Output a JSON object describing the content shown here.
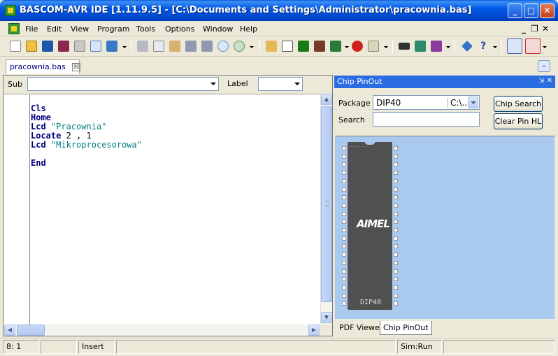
{
  "window": {
    "title": "BASCOM-AVR IDE [1.11.9.5] - [C:\\Documents and Settings\\Administrator\\pracownia.bas]",
    "controls": {
      "minimize": "_",
      "maximize": "□",
      "close": "✕"
    }
  },
  "menu": {
    "items": [
      "File",
      "Edit",
      "View",
      "Program",
      "Tools",
      "Options",
      "Window",
      "Help"
    ],
    "mdi_controls": {
      "minimize": "_",
      "restore": "❐",
      "close": "✕"
    }
  },
  "toolbar": {
    "icons": [
      "new-file-icon",
      "open-folder-icon",
      "save-icon",
      "save-as-icon",
      "print-icon",
      "print-preview-icon",
      "bookmark-icon",
      "cut-icon",
      "copy-icon",
      "paste-icon",
      "indent-icon",
      "unindent-icon",
      "find-icon",
      "find-next-icon",
      "hand-icon",
      "syntax-check-icon",
      "compile-icon",
      "chip-icon",
      "program-icon",
      "stop-icon",
      "terminal-icon",
      "chip-program-icon",
      "lcd-icon",
      "analyzer-icon",
      "info-icon",
      "help-icon",
      "chip-pinout-icon",
      "pdf-icon"
    ],
    "colors": {
      "save": "#1c56a8",
      "stop": "#d02020",
      "compile": "#1a7a1a",
      "pdf": "#c83030"
    }
  },
  "tabs": {
    "document": "pracownia.bas",
    "close": "☒",
    "chevron": "⌄"
  },
  "editor": {
    "sub_label": "Sub",
    "sub_value": "",
    "label_label": "Label",
    "label_value": "",
    "code": [
      {
        "parts": [
          {
            "t": "Cls",
            "c": "kw"
          }
        ]
      },
      {
        "parts": [
          {
            "t": "Home",
            "c": "kw"
          }
        ]
      },
      {
        "parts": [
          {
            "t": "Lcd",
            "c": "kw"
          },
          {
            "t": " ",
            "c": "num"
          },
          {
            "t": "\"Pracownia\"",
            "c": "str"
          }
        ]
      },
      {
        "parts": [
          {
            "t": "Locate",
            "c": "kw"
          },
          {
            "t": " 2 , 1",
            "c": "num"
          }
        ]
      },
      {
        "parts": [
          {
            "t": "Lcd",
            "c": "kw"
          },
          {
            "t": " ",
            "c": "num"
          },
          {
            "t": "\"Mikroprocesorowa\"",
            "c": "str"
          }
        ]
      },
      {
        "parts": []
      },
      {
        "parts": [
          {
            "t": "End",
            "c": "kw"
          }
        ]
      }
    ]
  },
  "chip_pinout": {
    "title": "Chip PinOut",
    "head_buttons": "⇲ ✕",
    "package_label": "Package",
    "package_value": "DIP40",
    "package_path": "C:\\...",
    "search_label": "Search",
    "search_value": "",
    "chip_search_button": "Chip Search",
    "clear_pin_button": "Clear Pin HL",
    "chip_logo": "AIMEL",
    "chip_label": "DIP40",
    "chip_topline": "· · · · · · ·",
    "pins_per_side": 20,
    "bottom_tabs": [
      "PDF Viewer",
      "Chip PinOut"
    ]
  },
  "statusbar": {
    "position": "8: 1",
    "cell2": "",
    "mode": "Insert",
    "cell4": "",
    "sim": "Sim:Run",
    "cell6": ""
  }
}
